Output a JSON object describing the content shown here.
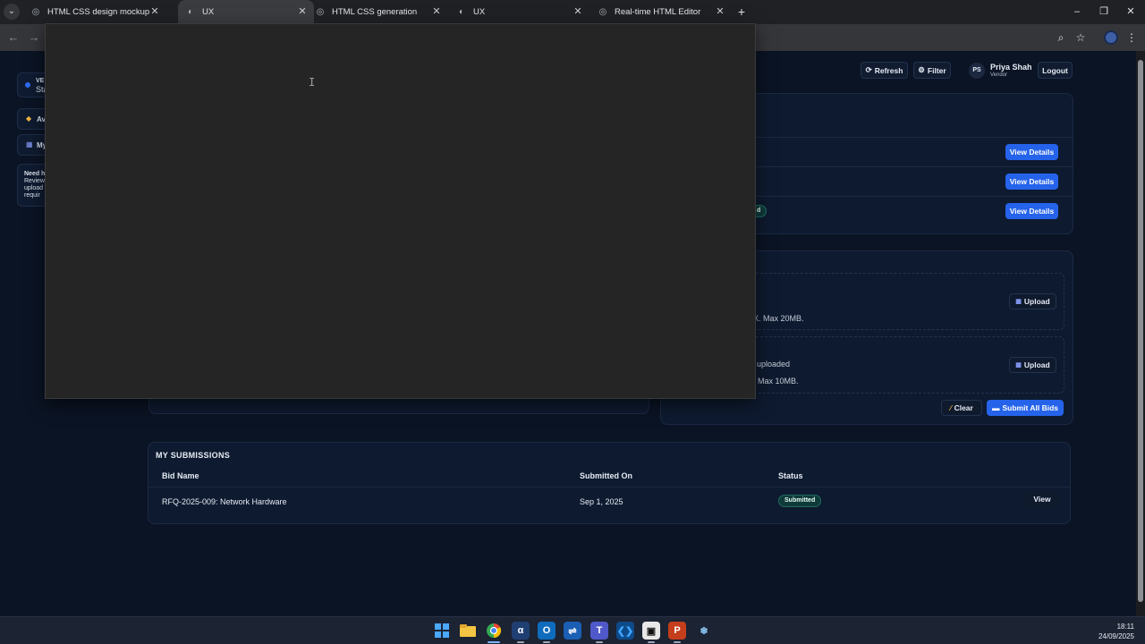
{
  "browser": {
    "tabs": [
      {
        "title": "HTML CSS design mockup",
        "icon": "globe-icon",
        "active": false
      },
      {
        "title": "UX",
        "icon": "compass-icon",
        "active": true
      },
      {
        "title": "HTML CSS generation",
        "icon": "globe-icon",
        "active": false
      },
      {
        "title": "UX",
        "icon": "compass-icon",
        "active": false
      },
      {
        "title": "Real-time HTML Editor",
        "icon": "globe-icon",
        "active": false
      }
    ],
    "new_tab_icon": "plus-icon"
  },
  "header": {
    "refresh_label": "Refresh",
    "filter_label": "Filter",
    "user": {
      "initials": "PS",
      "name": "Priya Shah",
      "role": "Vendor"
    },
    "logout_label": "Logout"
  },
  "sidebar": {
    "vendor_label": "VE",
    "vendor_status": "Sta",
    "items": [
      {
        "label": "Av",
        "icon": "tag-icon"
      },
      {
        "label": "My",
        "icon": "box-icon"
      }
    ],
    "help_lines": [
      "Need h",
      "Review",
      "upload",
      "requir"
    ]
  },
  "bids": {
    "rows": [
      {
        "action": "View Details"
      },
      {
        "action": "View Details"
      },
      {
        "badge": "d",
        "action": "View Details"
      }
    ]
  },
  "uploads": {
    "items": [
      {
        "note": "X. Max 20MB.",
        "action": "Upload"
      },
      {
        "status": "uploaded",
        "note": "/ Max 10MB.",
        "action": "Upload"
      }
    ],
    "clear_label": "Clear",
    "submit_label": "Submit All Bids"
  },
  "submissions": {
    "title": "MY SUBMISSIONS",
    "columns": [
      "Bid Name",
      "Submitted On",
      "Status"
    ],
    "rows": [
      {
        "name": "RFQ-2025-009: Network Hardware",
        "date": "Sep 1, 2025",
        "status": "Submitted",
        "action": "View"
      }
    ]
  },
  "taskbar": {
    "time": "18:11",
    "date": "24/09/2025"
  },
  "colors": {
    "accent": "#2563eb",
    "page_bg": "#0b1424",
    "panel_bg": "#0e1a2f",
    "badge_bg": "#0f3a3a"
  }
}
